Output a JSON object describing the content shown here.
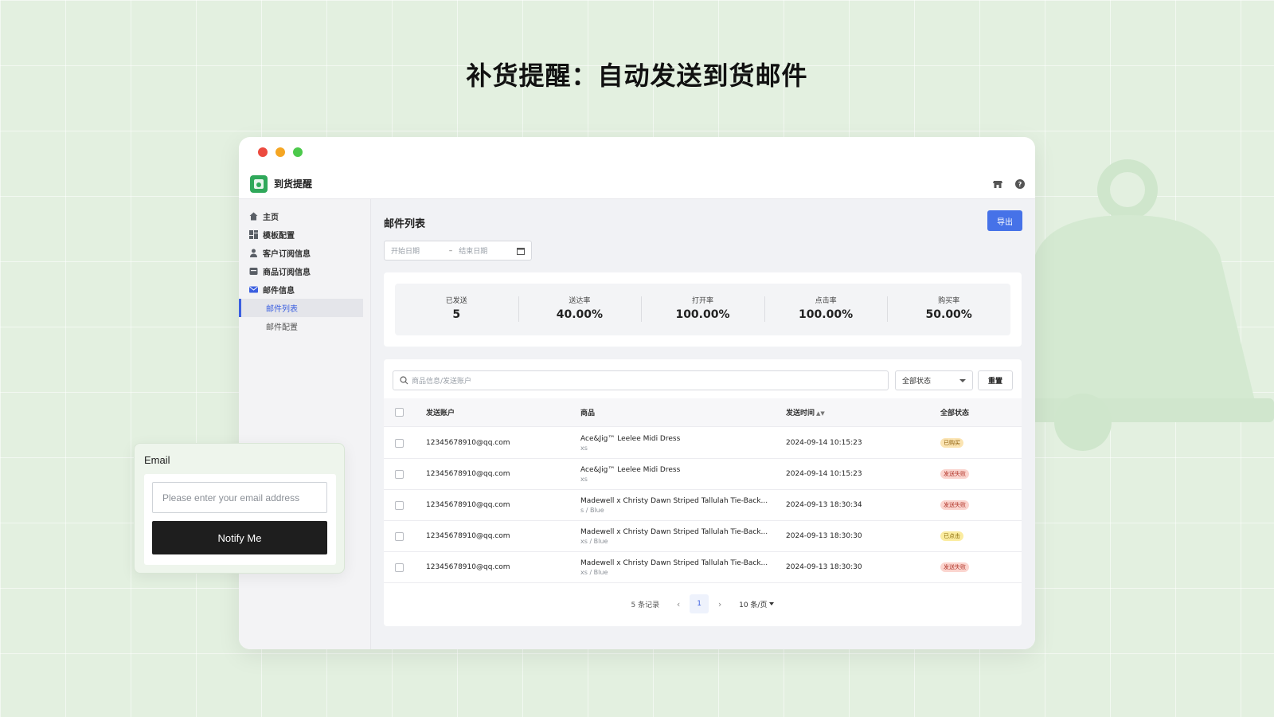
{
  "hero": {
    "title": "补货提醒：自动发送到货邮件"
  },
  "app": {
    "title": "到货提醒",
    "icons": [
      "store-icon",
      "help-icon"
    ]
  },
  "sidebar": {
    "items": [
      {
        "label": "主页",
        "icon": "home-icon"
      },
      {
        "label": "模板配置",
        "icon": "dashboard-icon"
      },
      {
        "label": "客户订阅信息",
        "icon": "user-icon"
      },
      {
        "label": "商品订阅信息",
        "icon": "box-icon"
      },
      {
        "label": "邮件信息",
        "icon": "mail-icon",
        "accent": "#3b5fe0"
      }
    ],
    "sub_items": [
      {
        "label": "邮件列表",
        "active": true
      },
      {
        "label": "邮件配置",
        "active": false
      }
    ]
  },
  "main": {
    "title": "邮件列表",
    "export_label": "导出",
    "date_start_placeholder": "开始日期",
    "date_end_placeholder": "结束日期",
    "stats": [
      {
        "label": "已发送",
        "value": "5"
      },
      {
        "label": "送达率",
        "value": "40.00%"
      },
      {
        "label": "打开率",
        "value": "100.00%"
      },
      {
        "label": "点击率",
        "value": "100.00%"
      },
      {
        "label": "购买率",
        "value": "50.00%"
      }
    ],
    "search_placeholder": "商品信息/发送账户",
    "status_filter": "全部状态",
    "reset_label": "重置",
    "columns": [
      "发送账户",
      "商品",
      "发送时间",
      "全部状态"
    ],
    "rows": [
      {
        "account": "12345678910@qq.com",
        "product": "Ace&Jig™ Leelee Midi Dress",
        "variant": "xs",
        "time": "2024-09-14 10:15:23",
        "status": "已购买",
        "status_type": "bought"
      },
      {
        "account": "12345678910@qq.com",
        "product": "Ace&Jig™ Leelee Midi Dress",
        "variant": "xs",
        "time": "2024-09-14 10:15:23",
        "status": "发送失败",
        "status_type": "failed"
      },
      {
        "account": "12345678910@qq.com",
        "product": "Madewell x Christy Dawn Striped Tallulah Tie-Back...",
        "variant": "s / Blue",
        "time": "2024-09-13 18:30:34",
        "status": "发送失败",
        "status_type": "failed"
      },
      {
        "account": "12345678910@qq.com",
        "product": "Madewell x Christy Dawn Striped Tallulah Tie-Back...",
        "variant": "xs / Blue",
        "time": "2024-09-13 18:30:30",
        "status": "已点击",
        "status_type": "clicked"
      },
      {
        "account": "12345678910@qq.com",
        "product": "Madewell x Christy Dawn Striped Tallulah Tie-Back...",
        "variant": "xs / Blue",
        "time": "2024-09-13 18:30:30",
        "status": "发送失败",
        "status_type": "failed"
      }
    ],
    "pager": {
      "total": "5 条记录",
      "page": "1",
      "page_size": "10 条/页"
    }
  },
  "widget": {
    "title": "Email",
    "placeholder": "Please enter your email address",
    "button": "Notify Me"
  },
  "colors": {
    "primary": "#4672e8",
    "background": "#e3f0e0",
    "logo": "#2fa85a"
  }
}
